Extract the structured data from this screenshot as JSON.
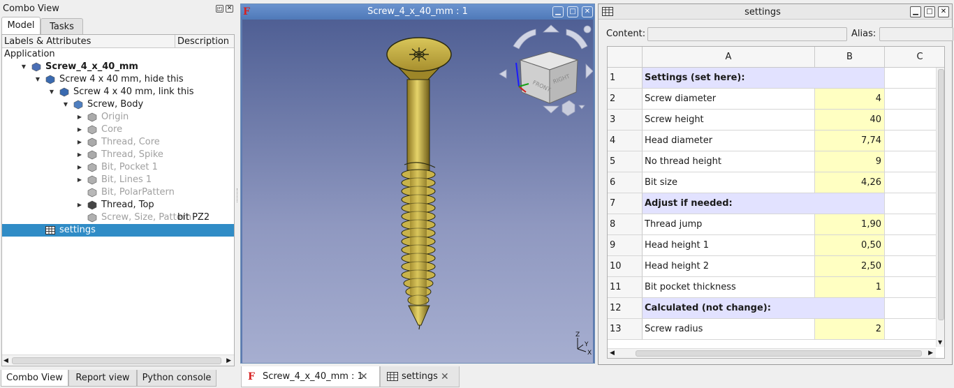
{
  "combo_view": {
    "title": "Combo View",
    "tabs": [
      "Model",
      "Tasks"
    ],
    "columns": [
      "Labels & Attributes",
      "Description"
    ],
    "tree": [
      {
        "label": "Application",
        "description": "",
        "state": "root"
      },
      {
        "label": "Screw_4_x_40_mm",
        "description": "",
        "state": "bold",
        "icon": "document-icon"
      },
      {
        "label": "Screw 4 x 40 mm, hide this",
        "description": "",
        "state": "normal",
        "icon": "link-icon"
      },
      {
        "label": "Screw 4 x 40 mm, link this",
        "description": "",
        "state": "normal",
        "icon": "link-icon"
      },
      {
        "label": "Screw, Body",
        "description": "",
        "state": "normal",
        "icon": "body-icon"
      },
      {
        "label": "Origin",
        "description": "",
        "state": "grey",
        "icon": "origin-icon"
      },
      {
        "label": "Core",
        "description": "",
        "state": "grey",
        "icon": "feature-icon"
      },
      {
        "label": "Thread, Core",
        "description": "",
        "state": "grey",
        "icon": "helix-icon"
      },
      {
        "label": "Thread, Spike",
        "description": "",
        "state": "grey",
        "icon": "helix-icon"
      },
      {
        "label": "Bit, Pocket 1",
        "description": "",
        "state": "grey",
        "icon": "pocket-icon"
      },
      {
        "label": "Bit, Lines 1",
        "description": "",
        "state": "grey",
        "icon": "pocket-icon"
      },
      {
        "label": "Bit, PolarPattern",
        "description": "",
        "state": "grey",
        "icon": "pattern-icon"
      },
      {
        "label": "Thread, Top",
        "description": "",
        "state": "normal",
        "icon": "helix-tip-icon"
      },
      {
        "label": "Screw, Size, Pattern",
        "description": "bit PZ2",
        "state": "grey",
        "icon": "clone-icon"
      },
      {
        "label": "settings",
        "description": "",
        "state": "selected",
        "icon": "spreadsheet-icon"
      }
    ],
    "bottom_tabs": [
      "Combo View",
      "Report view",
      "Python console"
    ]
  },
  "view3d": {
    "title": "Screw_4_x_40_mm : 1"
  },
  "sheet": {
    "title": "settings",
    "content_label": "Content:",
    "content_value": "",
    "alias_label": "Alias:",
    "alias_value": "",
    "columns": [
      "A",
      "B",
      "C"
    ],
    "rows": [
      {
        "n": "1",
        "a": "Settings (set here):",
        "b": "",
        "section": true
      },
      {
        "n": "2",
        "a": "Screw diameter",
        "b": "4"
      },
      {
        "n": "3",
        "a": "Screw height",
        "b": "40"
      },
      {
        "n": "4",
        "a": "Head diameter",
        "b": "7,74"
      },
      {
        "n": "5",
        "a": "No thread height",
        "b": "9"
      },
      {
        "n": "6",
        "a": "Bit size",
        "b": "4,26"
      },
      {
        "n": "7",
        "a": "Adjust if needed:",
        "b": "",
        "section": true
      },
      {
        "n": "8",
        "a": "Thread jump",
        "b": "1,90"
      },
      {
        "n": "9",
        "a": "Head height 1",
        "b": "0,50"
      },
      {
        "n": "10",
        "a": "Head height 2",
        "b": "2,50"
      },
      {
        "n": "11",
        "a": "Bit pocket thickness",
        "b": "1"
      },
      {
        "n": "12",
        "a": "Calculated (not change):",
        "b": "",
        "section": true
      },
      {
        "n": "13",
        "a": "Screw radius",
        "b": "2"
      }
    ]
  },
  "doc_tabs": [
    {
      "label": "Screw_4_x_40_mm : 1",
      "icon": "freecad-icon"
    },
    {
      "label": "settings",
      "icon": "spreadsheet-icon"
    }
  ],
  "colors": {
    "selection": "#308cc6",
    "section_fill": "#e2e2ff",
    "value_fill": "#ffffc2",
    "screw_gold": "#c9b34a"
  }
}
